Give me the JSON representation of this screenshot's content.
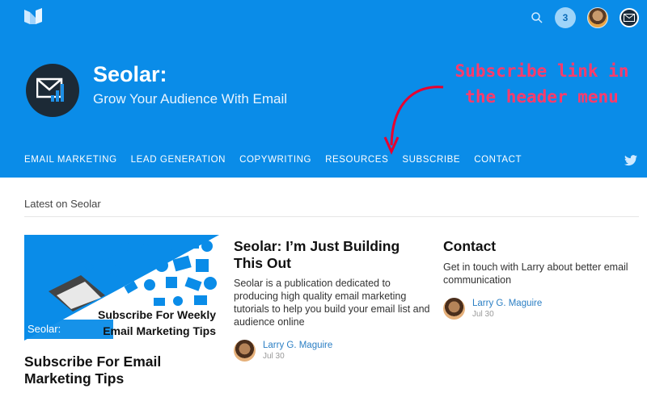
{
  "header": {
    "notification_count": "3",
    "brand_title": "Seolar:",
    "brand_subtitle": "Grow Your Audience With Email",
    "annotation": "Subscribe link in the header menu",
    "nav": [
      "EMAIL MARKETING",
      "LEAD GENERATION",
      "COPYWRITING",
      "RESOURCES",
      "SUBSCRIBE",
      "CONTACT"
    ],
    "colors": {
      "background": "#0a8ce8",
      "annotation": "#ff3b6b"
    }
  },
  "latest_label": "Latest on Seolar",
  "posts": [
    {
      "image_badge": "Seolar:",
      "image_cta_line1": "Subscribe For Weekly",
      "image_cta_line2": "Email Marketing Tips",
      "title": "Subscribe For Email Marketing Tips"
    },
    {
      "title": "Seolar: I’m Just Building This Out",
      "body": "Seolar is a publication dedicated to producing high quality email marketing tutorials to help you build your email list and audience online",
      "author": "Larry G. Maguire",
      "date": "Jul 30"
    },
    {
      "title": "Contact",
      "body": "Get in touch with Larry about better email communication",
      "author": "Larry G. Maguire",
      "date": "Jul 30"
    }
  ]
}
